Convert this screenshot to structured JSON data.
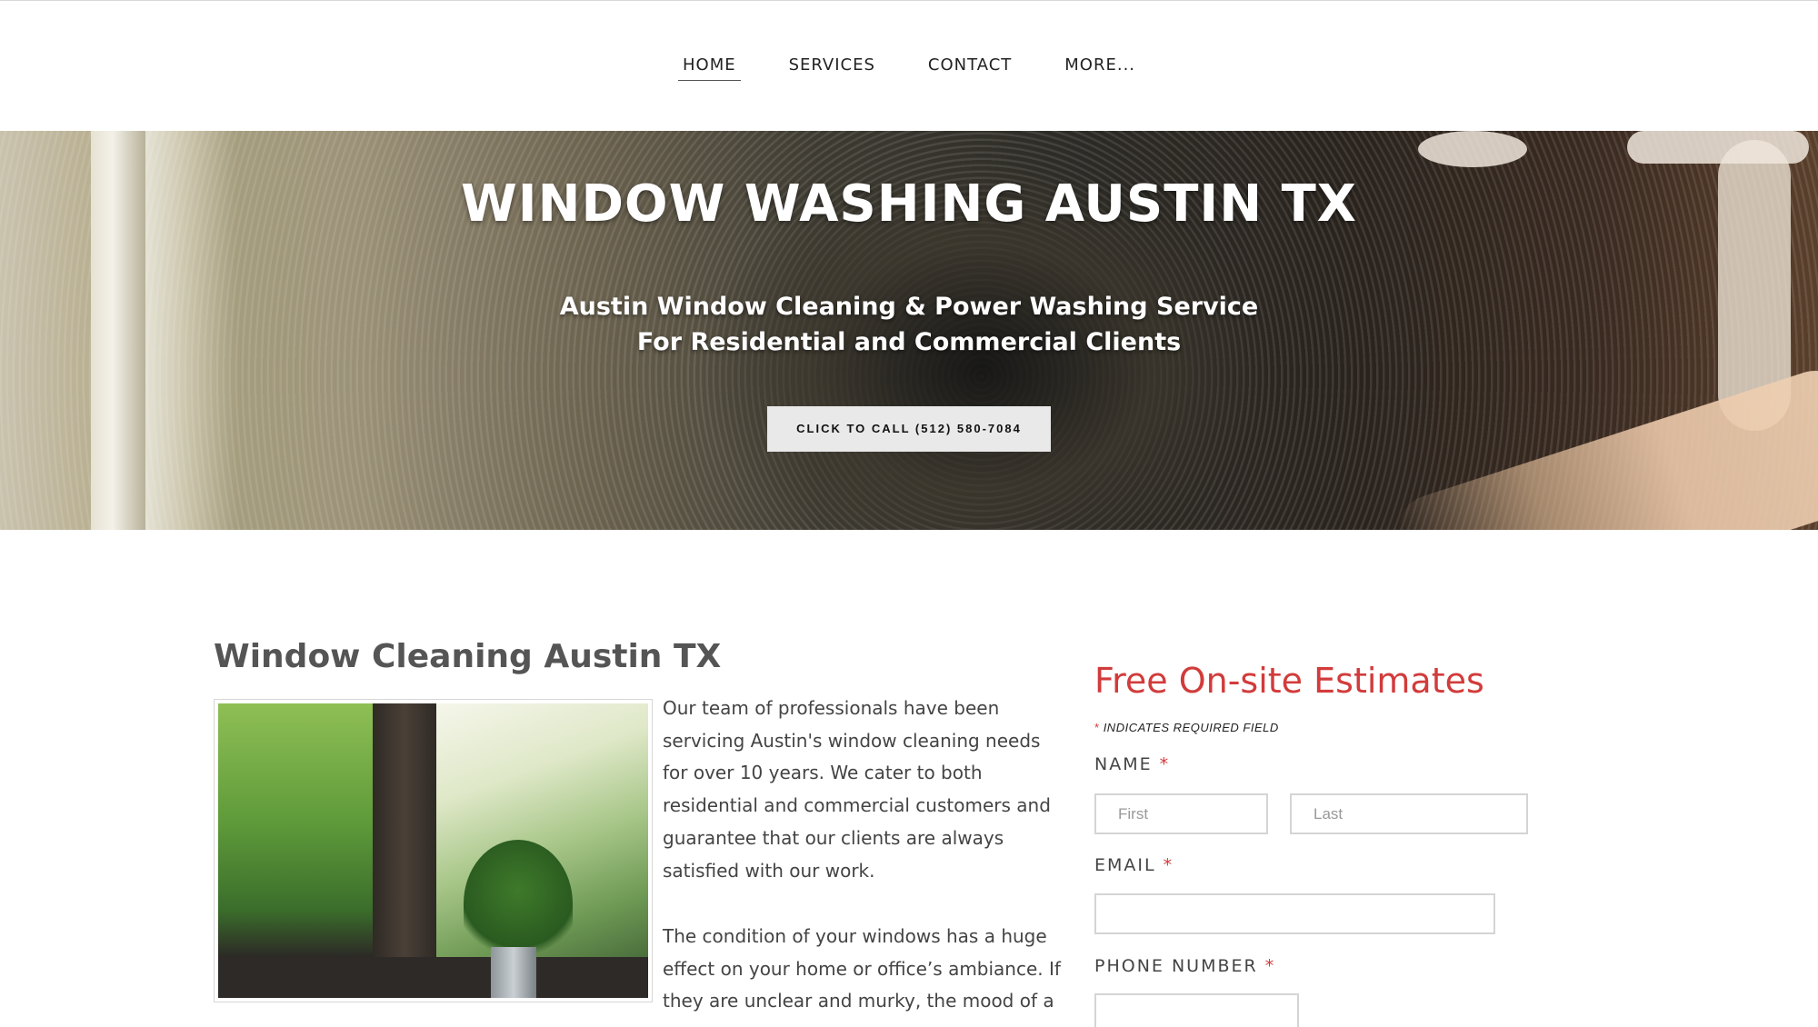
{
  "nav": {
    "items": [
      {
        "label": "HOME",
        "active": true
      },
      {
        "label": "SERVICES",
        "active": false
      },
      {
        "label": "CONTACT",
        "active": false
      },
      {
        "label": "MORE...",
        "active": false
      }
    ]
  },
  "hero": {
    "title": "WINDOW WASHING AUSTIN TX",
    "subtitle_line1": "Austin Window Cleaning & Power Washing Service",
    "subtitle_line2": "For Residential and Commercial Clients",
    "cta_label": "CLICK TO CALL (512) 580-7084"
  },
  "content": {
    "heading": "Window Cleaning Austin TX",
    "paragraph1": "Our team of professionals have been servicing Austin's window cleaning needs for over 10 years. We cater to both residential and commercial customers and guarantee that our clients are always satisfied with our work.",
    "paragraph2": "The condition of your windows has a huge effect on your home or office’s ambiance. If they are unclear and murky, the mood of a"
  },
  "form": {
    "title": "Free On-site Estimates",
    "required_star": "*",
    "required_note": "INDICATES REQUIRED FIELD",
    "name_label": "NAME",
    "first_placeholder": "First",
    "last_placeholder": "Last",
    "email_label": "EMAIL",
    "phone_label": "PHONE NUMBER"
  },
  "colors": {
    "accent_red": "#d23b3b",
    "cta_bg": "#e9e9e9"
  }
}
